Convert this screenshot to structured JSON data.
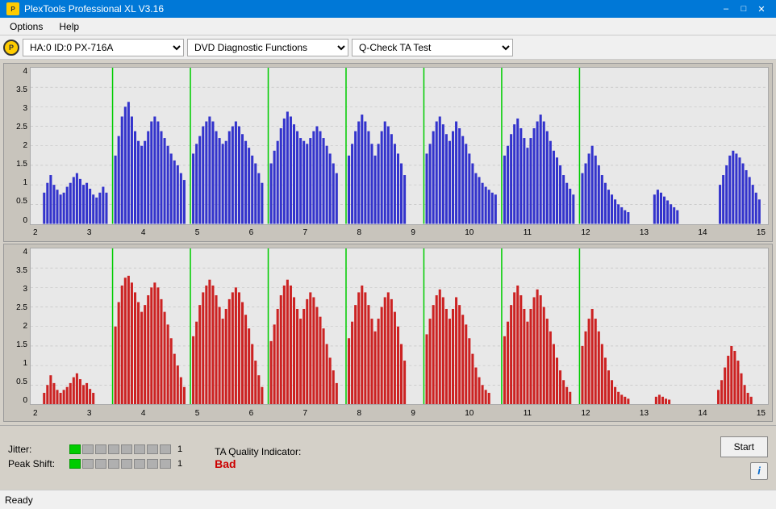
{
  "window": {
    "title": "PlexTools Professional XL V3.16"
  },
  "menu": {
    "options_label": "Options",
    "help_label": "Help"
  },
  "toolbar": {
    "drive_icon_label": "P",
    "drive_value": "HA:0 ID:0  PX-716A",
    "function_value": "DVD Diagnostic Functions",
    "test_value": "Q-Check TA Test"
  },
  "charts": {
    "top": {
      "color": "#3333cc",
      "y_labels": [
        "4",
        "3.5",
        "3",
        "2.5",
        "2",
        "1.5",
        "1",
        "0.5",
        "0"
      ],
      "x_labels": [
        "2",
        "3",
        "4",
        "5",
        "6",
        "7",
        "8",
        "9",
        "10",
        "11",
        "12",
        "13",
        "14",
        "15"
      ]
    },
    "bottom": {
      "color": "#cc2222",
      "y_labels": [
        "4",
        "3.5",
        "3",
        "2.5",
        "2",
        "1.5",
        "1",
        "0.5",
        "0"
      ],
      "x_labels": [
        "2",
        "3",
        "4",
        "5",
        "6",
        "7",
        "8",
        "9",
        "10",
        "11",
        "12",
        "13",
        "14",
        "15"
      ]
    }
  },
  "meters": {
    "jitter_label": "Jitter:",
    "jitter_value": "1",
    "jitter_active_segments": 1,
    "jitter_total_segments": 8,
    "peak_shift_label": "Peak Shift:",
    "peak_shift_value": "1",
    "peak_shift_active_segments": 1,
    "peak_shift_total_segments": 8
  },
  "ta_quality": {
    "label": "TA Quality Indicator:",
    "value": "Bad"
  },
  "buttons": {
    "start_label": "Start",
    "info_label": "i"
  },
  "status": {
    "text": "Ready"
  }
}
